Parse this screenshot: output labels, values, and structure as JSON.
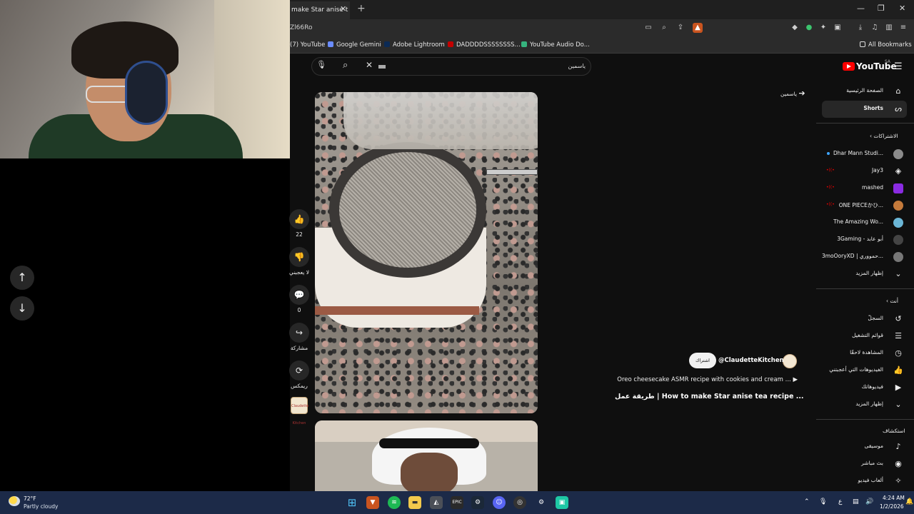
{
  "browser": {
    "tab_title": "make Star anise t",
    "url": "Zl66Ro",
    "bookmarks": [
      {
        "label": "(7) YouTube",
        "color": "#ff0000"
      },
      {
        "label": "Google Gemini",
        "color": "#6a8cff"
      },
      {
        "label": "Adobe Lightroom",
        "color": "#0b2a55"
      },
      {
        "label": "DADDDDSSSSSSSS...",
        "color": "#c40000"
      },
      {
        "label": "YouTube Audio Do...",
        "color": "#36b37e"
      }
    ],
    "all_bookmarks_label": "All Bookmarks"
  },
  "youtube": {
    "logo_text": "YouTube",
    "region": "SA",
    "search_value": "ياسمين",
    "back_label": "ياسمين",
    "sidebar": {
      "home": "الصفحة الرئيسية",
      "shorts": "Shorts",
      "subscriptions_header": "الاشتراكات",
      "subscriptions": [
        {
          "name": "Dhar Mann Studi...",
          "color": "#8b8b8b",
          "live": "",
          "new": true
        },
        {
          "name": "Jay3",
          "color": "#f1f1f1",
          "live": "•((•",
          "new": false
        },
        {
          "name": "mashed",
          "color": "#8a2be2",
          "live": "•((•",
          "new": false
        },
        {
          "name": "ONE PIECEかひ...",
          "color": "#c47a3b",
          "live": "•((•",
          "new": false
        },
        {
          "name": "The Amazing Wo...",
          "color": "#6bb6d6",
          "live": "",
          "new": false
        },
        {
          "name": "3Gaming - أبو عابد",
          "color": "#444444",
          "live": "",
          "new": false
        },
        {
          "name": "3moOoryXD | حمووري...",
          "color": "#777777",
          "live": "",
          "new": false
        }
      ],
      "show_more_1": "إظهار المزيد",
      "you_header": "أنت",
      "you_items": [
        "السجلّ",
        "قوائم التشغيل",
        "المشاهدة لاحقًا",
        "الفيديوهات التي أعجبتني",
        "فيديوهاتك"
      ],
      "show_more_2": "إظهار المزيد",
      "explore_header": "استكشاف",
      "explore_items": [
        "موسيقى",
        "بث مباشر",
        "ألعاب فيديو"
      ]
    },
    "short": {
      "likes": "22",
      "dislike_label": "لا يعجبني",
      "comments": "0",
      "share_label": "مشاركة",
      "remix_label": "ريمكس",
      "channel": "@ClaudetteKitchen",
      "subscribe": "اشتراك",
      "description": "Oreo cheesecake ASMR recipe with cookies and cream ...",
      "title": "طريقة عمل | How to make Star anise tea recipe ...",
      "thumb_text": "Claudette Kitchen"
    }
  },
  "taskbar": {
    "temp": "72°F",
    "weather": "Partly cloudy",
    "time": "4:24 AM",
    "date": "1/2/2026",
    "lang": "ع"
  }
}
